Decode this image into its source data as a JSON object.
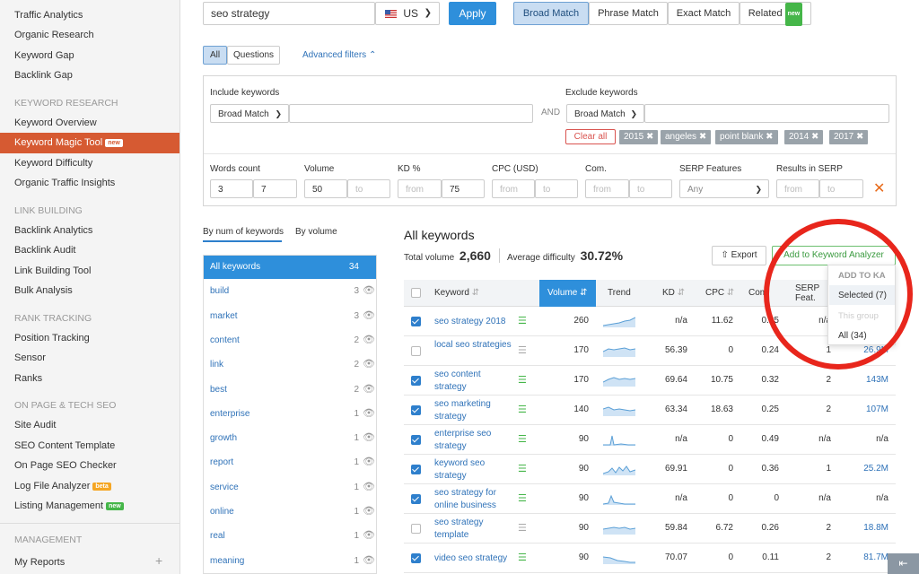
{
  "sidebar": {
    "items_top": [
      "Traffic Analytics",
      "Organic Research",
      "Keyword Gap",
      "Backlink Gap"
    ],
    "sections": [
      {
        "title": "KEYWORD RESEARCH",
        "items": [
          "Keyword Overview",
          "Keyword Magic Tool",
          "Keyword Difficulty",
          "Organic Traffic Insights"
        ]
      },
      {
        "title": "LINK BUILDING",
        "items": [
          "Backlink Analytics",
          "Backlink Audit",
          "Link Building Tool",
          "Bulk Analysis"
        ]
      },
      {
        "title": "RANK TRACKING",
        "items": [
          "Position Tracking",
          "Sensor",
          "Ranks"
        ]
      },
      {
        "title": "ON PAGE & TECH SEO",
        "items": [
          "Site Audit",
          "SEO Content Template",
          "On Page SEO Checker",
          "Log File Analyzer",
          "Listing Management"
        ]
      },
      {
        "title": "MANAGEMENT",
        "items": [
          "My Reports"
        ]
      }
    ],
    "tag_new": "new",
    "tag_beta": "beta"
  },
  "search": {
    "query": "seo strategy",
    "country": "US",
    "apply": "Apply"
  },
  "match_tabs": [
    "Broad Match",
    "Phrase Match",
    "Exact Match",
    "Related"
  ],
  "sub_tabs": [
    "All",
    "Questions"
  ],
  "advanced_filters": "Advanced filters",
  "include": {
    "label": "Include keywords",
    "select": "Broad Match"
  },
  "and": "AND",
  "exclude": {
    "label": "Exclude keywords",
    "select": "Broad Match",
    "clear": "Clear all",
    "chips": [
      "2015",
      "angeles",
      "point blank",
      "2014",
      "2017"
    ]
  },
  "filters": {
    "words_count": {
      "label": "Words count",
      "from": "3",
      "to": "7"
    },
    "volume": {
      "label": "Volume",
      "from": "50",
      "to_ph": "to"
    },
    "kd": {
      "label": "KD %",
      "from_ph": "from",
      "to": "75"
    },
    "cpc": {
      "label": "CPC (USD)",
      "from_ph": "from",
      "to_ph": "to"
    },
    "com": {
      "label": "Com.",
      "from_ph": "from",
      "to_ph": "to"
    },
    "serp": {
      "label": "SERP Features",
      "value": "Any"
    },
    "results": {
      "label": "Results in SERP",
      "from_ph": "from",
      "to_ph": "to"
    }
  },
  "group_tabs": [
    "By num of keywords",
    "By volume"
  ],
  "groups": [
    {
      "name": "All keywords",
      "count": "34"
    },
    {
      "name": "build",
      "count": "3"
    },
    {
      "name": "market",
      "count": "3"
    },
    {
      "name": "content",
      "count": "2"
    },
    {
      "name": "link",
      "count": "2"
    },
    {
      "name": "best",
      "count": "2"
    },
    {
      "name": "enterprise",
      "count": "1"
    },
    {
      "name": "growth",
      "count": "1"
    },
    {
      "name": "report",
      "count": "1"
    },
    {
      "name": "service",
      "count": "1"
    },
    {
      "name": "online",
      "count": "1"
    },
    {
      "name": "real",
      "count": "1"
    },
    {
      "name": "meaning",
      "count": "1"
    }
  ],
  "results": {
    "title": "All keywords",
    "total_label": "Total volume",
    "total": "2,660",
    "diff_label": "Average difficulty",
    "diff": "30.72%",
    "export": "Export",
    "add_ka": "Add to Keyword Analyzer"
  },
  "dropdown": {
    "header": "ADD TO KA",
    "items": [
      "Selected (7)",
      "This group",
      "All (34)"
    ]
  },
  "columns": {
    "keyword": "Keyword",
    "volume": "Volume",
    "trend": "Trend",
    "kd": "KD",
    "cpc": "CPC",
    "com": "Com",
    "serp_a": "SERP",
    "serp_b": "Feat."
  },
  "rows": [
    {
      "kw": "seo strategy 2018",
      "sel": true,
      "vol": "260",
      "kd": "n/a",
      "cpc": "11.62",
      "com": "0.25",
      "serp": "n/a",
      "res": ""
    },
    {
      "kw": "local seo strategies",
      "sel": false,
      "vol": "170",
      "kd": "56.39",
      "cpc": "0",
      "com": "0.24",
      "serp": "1",
      "res": "26.9M"
    },
    {
      "kw": "seo content strategy",
      "sel": true,
      "vol": "170",
      "kd": "69.64",
      "cpc": "10.75",
      "com": "0.32",
      "serp": "2",
      "res": "143M"
    },
    {
      "kw": "seo marketing strategy",
      "sel": true,
      "vol": "140",
      "kd": "63.34",
      "cpc": "18.63",
      "com": "0.25",
      "serp": "2",
      "res": "107M"
    },
    {
      "kw": "enterprise seo strategy",
      "sel": true,
      "vol": "90",
      "kd": "n/a",
      "cpc": "0",
      "com": "0.49",
      "serp": "n/a",
      "res": "n/a"
    },
    {
      "kw": "keyword seo strategy",
      "sel": true,
      "vol": "90",
      "kd": "69.91",
      "cpc": "0",
      "com": "0.36",
      "serp": "1",
      "res": "25.2M"
    },
    {
      "kw": "seo strategy for online business",
      "sel": true,
      "vol": "90",
      "kd": "n/a",
      "cpc": "0",
      "com": "0",
      "serp": "n/a",
      "res": "n/a"
    },
    {
      "kw": "seo strategy template",
      "sel": false,
      "vol": "90",
      "kd": "59.84",
      "cpc": "6.72",
      "com": "0.26",
      "serp": "2",
      "res": "18.8M"
    },
    {
      "kw": "video seo strategy",
      "sel": true,
      "vol": "90",
      "kd": "70.07",
      "cpc": "0",
      "com": "0.11",
      "serp": "2",
      "res": "81.7M"
    }
  ],
  "colors": {
    "accent": "#d65a32",
    "primary": "#2e7fcc",
    "highlight_circle": "#e8261c",
    "green": "#45b649"
  }
}
